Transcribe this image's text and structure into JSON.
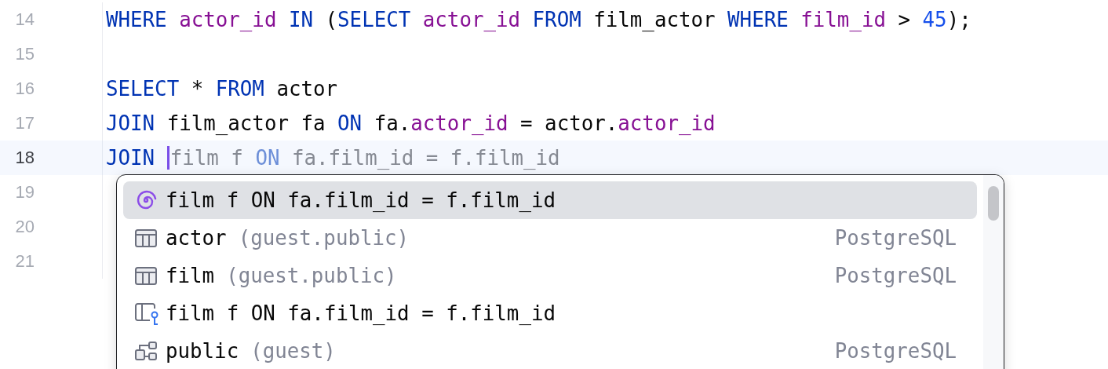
{
  "editor": {
    "lines": [
      {
        "number": "14",
        "current": false,
        "tokens": [
          {
            "kind": "keyword",
            "text": "WHERE"
          },
          {
            "kind": "column",
            "text": " actor_id"
          },
          {
            "kind": "keyword",
            "text": " IN"
          },
          {
            "kind": "plain",
            "text": " ("
          },
          {
            "kind": "keyword",
            "text": "SELECT"
          },
          {
            "kind": "column",
            "text": " actor_id"
          },
          {
            "kind": "keyword",
            "text": " FROM"
          },
          {
            "kind": "plain",
            "text": " film_actor "
          },
          {
            "kind": "keyword",
            "text": "WHERE"
          },
          {
            "kind": "column",
            "text": " film_id"
          },
          {
            "kind": "plain",
            "text": " > "
          },
          {
            "kind": "number",
            "text": "45"
          },
          {
            "kind": "plain",
            "text": ");"
          }
        ]
      },
      {
        "number": "15",
        "current": false
      },
      {
        "number": "16",
        "current": false,
        "tokens": [
          {
            "kind": "keyword",
            "text": "SELECT"
          },
          {
            "kind": "plain",
            "text": " * "
          },
          {
            "kind": "keyword",
            "text": "FROM"
          },
          {
            "kind": "plain",
            "text": " actor"
          }
        ]
      },
      {
        "number": "17",
        "current": false,
        "tokens": [
          {
            "kind": "keyword",
            "text": "JOIN"
          },
          {
            "kind": "plain",
            "text": " film_actor fa "
          },
          {
            "kind": "keyword",
            "text": "ON"
          },
          {
            "kind": "plain",
            "text": " fa."
          },
          {
            "kind": "column",
            "text": "actor_id"
          },
          {
            "kind": "plain",
            "text": " = actor."
          },
          {
            "kind": "column",
            "text": "actor_id"
          }
        ]
      },
      {
        "number": "18",
        "current": true,
        "tokens": [
          {
            "kind": "keyword",
            "text": "JOIN "
          },
          {
            "kind": "caret"
          },
          {
            "kind": "hint",
            "text": "film f "
          },
          {
            "kind": "hint-keyword",
            "text": "ON"
          },
          {
            "kind": "hint",
            "text": " fa.film_id = f.film_id"
          }
        ]
      },
      {
        "number": "19",
        "current": false
      },
      {
        "number": "20",
        "current": false
      },
      {
        "number": "21",
        "current": false
      }
    ]
  },
  "completion": {
    "items": [
      {
        "kind": "ai",
        "text": "film f ON fa.film_id = f.film_id",
        "selected": true
      },
      {
        "kind": "table",
        "text": "actor",
        "detail": "(guest.public)",
        "source": "PostgreSQL",
        "selected": false
      },
      {
        "kind": "table",
        "text": "film",
        "detail": "(guest.public)",
        "source": "PostgreSQL",
        "selected": false
      },
      {
        "kind": "join",
        "text": "film f ON fa.film_id = f.film_id",
        "selected": false
      },
      {
        "kind": "schema",
        "text": "public",
        "detail": "(guest)",
        "source": "PostgreSQL",
        "selected": false
      }
    ]
  }
}
